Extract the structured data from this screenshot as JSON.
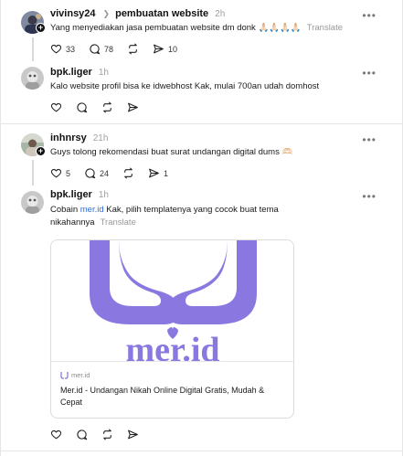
{
  "posts": [
    {
      "username": "vivinsy24",
      "crumb": "pembuatan website",
      "time": "2h",
      "text": "Yang menyediakan jasa pembuatan website dm donk 🙏🏻🙏🏻🙏🏻🙏🏻",
      "translate": "Translate",
      "likes": "33",
      "replies": "78",
      "reposts": "",
      "shares": "10"
    },
    {
      "username": "bpk.liger",
      "time": "1h",
      "text": "Kalo website profil bisa ke idwebhost Kak, mulai 700an udah domhost"
    },
    {
      "username": "inhnrsy",
      "time": "21h",
      "text": "Guys tolong rekomendasi buat surat undangan digital dums 🫶🏻",
      "likes": "5",
      "replies": "24",
      "shares": "1"
    },
    {
      "username": "bpk.liger",
      "time": "1h",
      "text_before": "Cobain ",
      "link": "mer.id",
      "text_after": " Kak, pilih templatenya yang cocok buat tema nikahannya",
      "translate": "Translate",
      "card": {
        "domain": "mer.id",
        "title": "Mer.id - Undangan Nikah Online Digital Gratis, Mudah & Cepat",
        "logo_color": "#8a78e0",
        "logo_text": "mer.id"
      }
    }
  ],
  "more_label": "•••",
  "icons": [
    "heart-icon",
    "comment-icon",
    "repost-icon",
    "share-icon",
    "more-icon",
    "chevron-right-icon"
  ]
}
